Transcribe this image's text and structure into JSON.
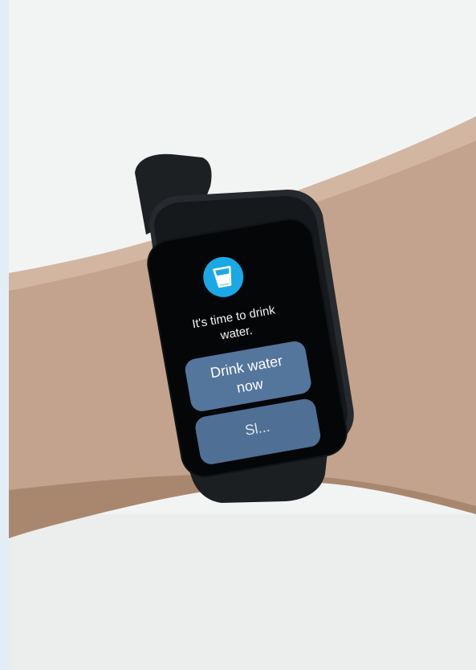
{
  "watch": {
    "app_icon": "water-glass-icon",
    "reminder_text": "It's time to drink\nwater.",
    "primary_button_label": "Drink water\nnow",
    "secondary_button_label": "Sl..."
  },
  "colors": {
    "background": "#f1f3f3",
    "skin": "#c2a28c",
    "watch_body": "#23272b",
    "strap": "#1c1f22",
    "screen": "#050608",
    "icon_accent": "#1aa8e6",
    "button": "#54759c"
  }
}
